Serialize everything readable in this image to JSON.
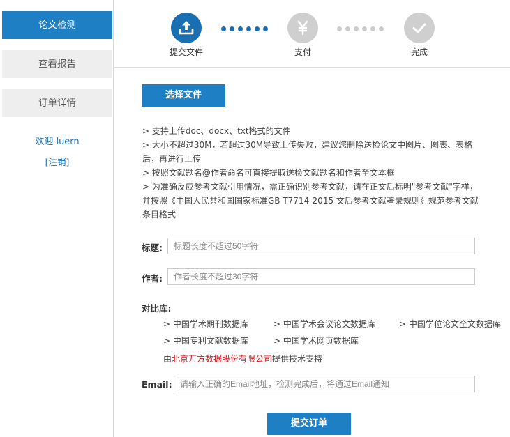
{
  "sidebar": {
    "items": [
      {
        "label": "论文检测",
        "active": true
      },
      {
        "label": "查看报告",
        "active": false
      },
      {
        "label": "订单详情",
        "active": false
      }
    ],
    "welcome": "欢迎 luern",
    "logout": "[注销]"
  },
  "steps": [
    {
      "label": "提交文件",
      "icon": "upload-icon",
      "state": "current"
    },
    {
      "label": "支付",
      "icon": "yen-icon",
      "state": "pending"
    },
    {
      "label": "完成",
      "icon": "check-icon",
      "state": "pending"
    }
  ],
  "upload": {
    "button_label": "选择文件"
  },
  "tips": [
    "> 支持上传doc、docx、txt格式的文件",
    "> 大小不超过30M，若超过30M导致上传失败，建议您删除送检论文中图片、图表、表格后，再进行上传",
    "> 按照文献题名@作者命名可直接提取送检文献题名和作者至文本框",
    "> 为准确反应参考文献引用情况，需正确识别参考文献，请在正文后标明\"参考文献\"字样，并按照《中国人民共和国国家标准GB T7714-2015 文后参考文献著录规则》规范参考文献条目格式"
  ],
  "form": {
    "title_label": "标题:",
    "title_placeholder": "标题长度不超过50字符",
    "author_label": "作者:",
    "author_placeholder": "作者长度不超过30字符",
    "compare_label": "对比库:",
    "databases": [
      "> 中国学术期刊数据库",
      "> 中国学术会议论文数据库",
      "> 中国学位论文全文数据库",
      "> 中国专利文献数据库",
      "> 中国学术网页数据库"
    ],
    "support_prefix": "由",
    "support_company": "北京万方数据股份有限公司",
    "support_suffix": "提供技术支持",
    "email_label": "Email:",
    "email_placeholder": "请输入正确的Email地址，检测完成后，将通过Email通知",
    "submit_label": "提交订单"
  },
  "colors": {
    "primary": "#1f7fc4",
    "step_active": "#1a6fb3",
    "step_inactive": "#cfcfcf",
    "company_red": "#d9151b"
  }
}
